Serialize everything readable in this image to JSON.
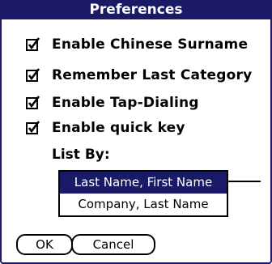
{
  "dialog": {
    "title": "Preferences",
    "options": [
      {
        "label": "Enable Chinese Surname",
        "checked": true
      },
      {
        "label": "Remember Last Category",
        "checked": true
      },
      {
        "label": "Enable Tap-Dialing",
        "checked": true
      },
      {
        "label": "Enable quick key",
        "checked": true
      }
    ],
    "list_by_label": "List By:",
    "list_options": [
      {
        "label": "Last Name, First Name",
        "selected": true
      },
      {
        "label": "Company, Last Name",
        "selected": false
      }
    ],
    "ok_label": "OK",
    "cancel_label": "Cancel"
  },
  "colors": {
    "title_bar": "#1a1a66",
    "selection": "#1a1a66"
  },
  "icons": {
    "checkbox": "checkbox-checked-icon"
  }
}
